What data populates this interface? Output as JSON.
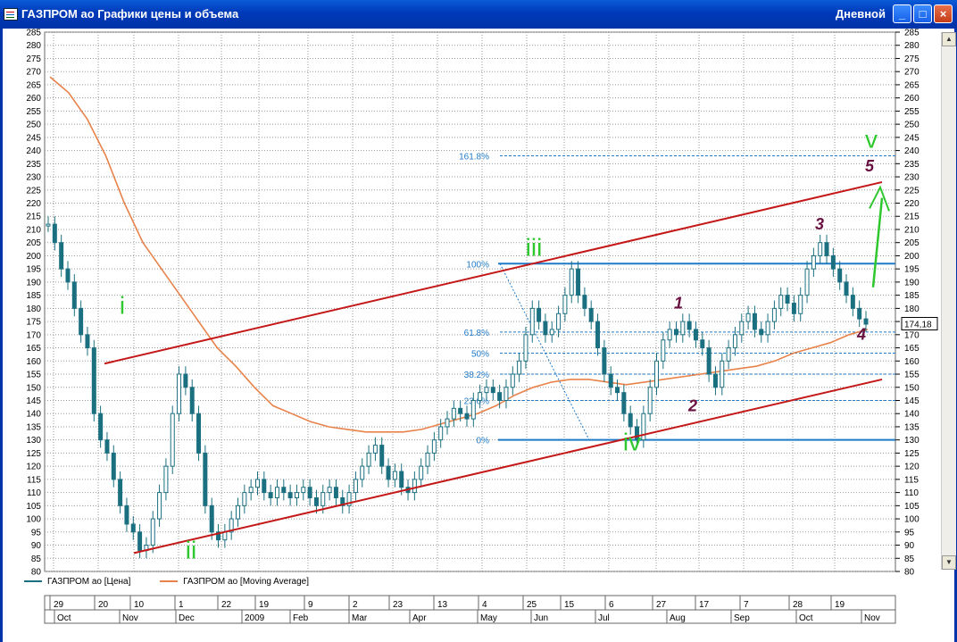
{
  "window": {
    "title": "ГАЗПРОМ ао Графики цены и объема",
    "mode": "Дневной",
    "buttons": {
      "minimize": "_",
      "maximize": "□",
      "close": "×"
    }
  },
  "colors": {
    "price": "#1b7080",
    "ma": "#e8824a",
    "trend": "#c41818",
    "fib": "#1f7ac8",
    "green_label": "#2ec82e",
    "purple_label": "#6a1040",
    "grid": "#999999"
  },
  "legend": [
    {
      "label": "ГАЗПРОМ ао [Цена]",
      "color": "#1b7080"
    },
    {
      "label": "ГАЗПРОМ ао [Moving Average]",
      "color": "#e8824a"
    }
  ],
  "chart_data": {
    "type": "line",
    "title": "",
    "yaxis": {
      "min": 80,
      "max": 285,
      "step": 5,
      "both_sides": true
    },
    "last_price_label": "174,18",
    "x_ticks": [
      "29",
      "20",
      "10",
      "1",
      "22",
      "19",
      "9",
      "2",
      "23",
      "13",
      "4",
      "25",
      "15",
      "6",
      "27",
      "17",
      "7",
      "28",
      "19"
    ],
    "x_months": [
      "Oct",
      "Nov",
      "Dec",
      "2009",
      "Feb",
      "Mar",
      "Apr",
      "May",
      "Jun",
      "Jul",
      "Aug",
      "Sep",
      "Oct",
      "Nov"
    ],
    "series": [
      {
        "name": "ГАЗПРОМ ао [Цена]",
        "values": [
          212,
          205,
          195,
          190,
          180,
          170,
          165,
          140,
          130,
          125,
          115,
          105,
          98,
          95,
          88,
          90,
          100,
          110,
          120,
          140,
          155,
          150,
          140,
          125,
          105,
          95,
          92,
          95,
          100,
          105,
          110,
          112,
          115,
          110,
          108,
          112,
          110,
          108,
          110,
          112,
          108,
          105,
          110,
          112,
          108,
          105,
          110,
          115,
          120,
          125,
          128,
          120,
          115,
          118,
          112,
          110,
          115,
          120,
          125,
          130,
          135,
          138,
          142,
          140,
          138,
          145,
          148,
          150,
          148,
          145,
          150,
          155,
          160,
          170,
          180,
          175,
          170,
          172,
          178,
          185,
          195,
          185,
          180,
          175,
          165,
          155,
          150,
          148,
          140,
          135,
          130,
          140,
          150,
          160,
          168,
          172,
          170,
          175,
          172,
          168,
          165,
          155,
          150,
          160,
          165,
          170,
          175,
          178,
          172,
          170,
          175,
          180,
          185,
          182,
          178,
          185,
          195,
          200,
          205,
          200,
          195,
          190,
          185,
          180,
          176,
          174
        ]
      },
      {
        "name": "ГАЗПРОМ ао [Moving Average]",
        "values": [
          268,
          262,
          252,
          238,
          220,
          205,
          195,
          185,
          175,
          165,
          158,
          150,
          143,
          140,
          137,
          135,
          134,
          133,
          133,
          133,
          134,
          136,
          138,
          140,
          143,
          147,
          150,
          152,
          153,
          153,
          152,
          151,
          152,
          153,
          154,
          155,
          156,
          157,
          158,
          160,
          163,
          165,
          167,
          170,
          172
        ]
      }
    ],
    "trend_lines": [
      {
        "name": "upper-channel",
        "from": {
          "x": "20 Nov",
          "y": 159
        },
        "to": {
          "x": "Nov",
          "y": 228
        }
      },
      {
        "name": "lower-channel",
        "from": {
          "x": "10 Nov",
          "y": 87
        },
        "to": {
          "x": "Nov",
          "y": 153
        }
      }
    ],
    "fibonacci": [
      {
        "label": "161.8%",
        "y": 238
      },
      {
        "label": "100%",
        "y": 197
      },
      {
        "label": "61.8%",
        "y": 171
      },
      {
        "label": "50%",
        "y": 163
      },
      {
        "label": "38.2%",
        "y": 155
      },
      {
        "label": "23.6%",
        "y": 145
      },
      {
        "label": "0%",
        "y": 130
      }
    ],
    "annotations": [
      {
        "text": "i",
        "kind": "green",
        "price": 178
      },
      {
        "text": "ii",
        "kind": "green",
        "price": 85
      },
      {
        "text": "iii",
        "kind": "green",
        "price": 200
      },
      {
        "text": "iv",
        "kind": "green",
        "price": 126
      },
      {
        "text": "v",
        "kind": "green",
        "price": 241
      },
      {
        "text": "1",
        "kind": "purple",
        "price": 180
      },
      {
        "text": "2",
        "kind": "purple",
        "price": 141
      },
      {
        "text": "3",
        "kind": "purple",
        "price": 210
      },
      {
        "text": "4",
        "kind": "purple",
        "price": 168
      },
      {
        "text": "5",
        "kind": "purple",
        "price": 232
      }
    ]
  }
}
